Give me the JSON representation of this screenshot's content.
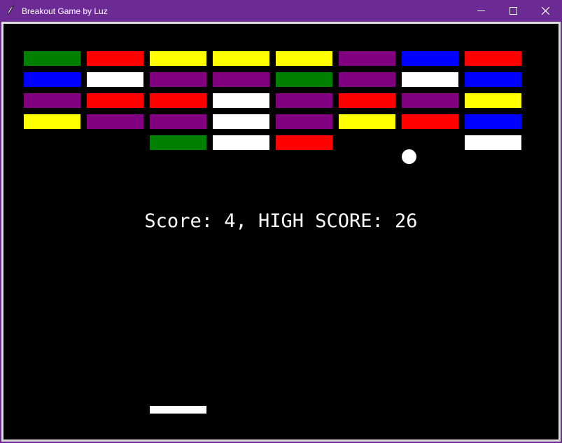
{
  "window": {
    "title": "Breakout Game by Luz",
    "title_color": "#6b2a94",
    "icons": [
      "feather-icon",
      "minimize-icon",
      "maximize-icon",
      "close-icon"
    ]
  },
  "game": {
    "background": "#000000",
    "score_text": "Score: 4, HIGH SCORE: 26",
    "score": 4,
    "high_score": 26,
    "ball_color": "#ffffff",
    "paddle_color": "#ffffff",
    "palette": {
      "G": "#008000",
      "R": "#ff0000",
      "Y": "#ffff00",
      "P": "#800080",
      "B": "#0000ff",
      "W": "#ffffff"
    },
    "brick_grid": [
      [
        "G",
        "R",
        "Y",
        "Y",
        "Y",
        "P",
        "B",
        "R"
      ],
      [
        "B",
        "W",
        "P",
        "P",
        "G",
        "P",
        "W",
        "B"
      ],
      [
        "P",
        "R",
        "R",
        "W",
        "P",
        "R",
        "P",
        "Y"
      ],
      [
        "Y",
        "P",
        "P",
        "W",
        "P",
        "Y",
        "R",
        "B"
      ],
      [
        "",
        "",
        "G",
        "W",
        "R",
        "",
        "",
        "W"
      ]
    ]
  }
}
